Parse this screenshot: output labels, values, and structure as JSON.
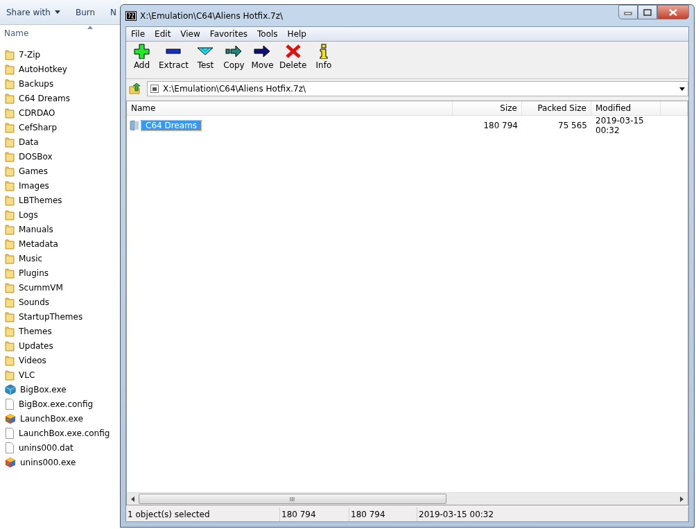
{
  "explorer": {
    "toolbar": [
      "Share with",
      "Burn",
      "N"
    ],
    "column": "Name",
    "items": [
      {
        "name": "7-Zip",
        "kind": "folder"
      },
      {
        "name": "AutoHotkey",
        "kind": "folder"
      },
      {
        "name": "Backups",
        "kind": "folder"
      },
      {
        "name": "C64 Dreams",
        "kind": "folder"
      },
      {
        "name": "CDRDAO",
        "kind": "folder"
      },
      {
        "name": "CefSharp",
        "kind": "folder"
      },
      {
        "name": "Data",
        "kind": "folder"
      },
      {
        "name": "DOSBox",
        "kind": "folder"
      },
      {
        "name": "Games",
        "kind": "folder"
      },
      {
        "name": "Images",
        "kind": "folder"
      },
      {
        "name": "LBThemes",
        "kind": "folder"
      },
      {
        "name": "Logs",
        "kind": "folder"
      },
      {
        "name": "Manuals",
        "kind": "folder"
      },
      {
        "name": "Metadata",
        "kind": "folder"
      },
      {
        "name": "Music",
        "kind": "folder"
      },
      {
        "name": "Plugins",
        "kind": "folder"
      },
      {
        "name": "ScummVM",
        "kind": "folder"
      },
      {
        "name": "Sounds",
        "kind": "folder"
      },
      {
        "name": "StartupThemes",
        "kind": "folder"
      },
      {
        "name": "Themes",
        "kind": "folder"
      },
      {
        "name": "Updates",
        "kind": "folder"
      },
      {
        "name": "Videos",
        "kind": "folder"
      },
      {
        "name": "VLC",
        "kind": "folder"
      },
      {
        "name": "BigBox.exe",
        "kind": "cube"
      },
      {
        "name": "BigBox.exe.config",
        "kind": "document"
      },
      {
        "name": "LaunchBox.exe",
        "kind": "multicube"
      },
      {
        "name": "LaunchBox.exe.config",
        "kind": "document"
      },
      {
        "name": "unins000.dat",
        "kind": "document"
      },
      {
        "name": "unins000.exe",
        "kind": "multicube"
      }
    ]
  },
  "window": {
    "title": "X:\\Emulation\\C64\\Aliens Hotfix.7z\\",
    "menu": [
      "File",
      "Edit",
      "View",
      "Favorites",
      "Tools",
      "Help"
    ],
    "toolbar": [
      {
        "label": "Add",
        "kind": "add"
      },
      {
        "label": "Extract",
        "kind": "extract"
      },
      {
        "label": "Test",
        "kind": "test"
      },
      {
        "label": "Copy",
        "kind": "copy"
      },
      {
        "label": "Move",
        "kind": "move"
      },
      {
        "label": "Delete",
        "kind": "delete"
      },
      {
        "label": "Info",
        "kind": "info"
      }
    ],
    "address": "X:\\Emulation\\C64\\Aliens Hotfix.7z\\",
    "table": {
      "columns": [
        "Name",
        "Size",
        "Packed Size",
        "Modified"
      ],
      "rows": [
        {
          "cells": [
            "C64 Dreams",
            "180 794",
            "75 565",
            "2019-03-15 00:32"
          ],
          "selected": true
        }
      ]
    },
    "status_bar": [
      "1 object(s) selected",
      "180 794",
      "180 794",
      "2019-03-15 00:32"
    ]
  }
}
